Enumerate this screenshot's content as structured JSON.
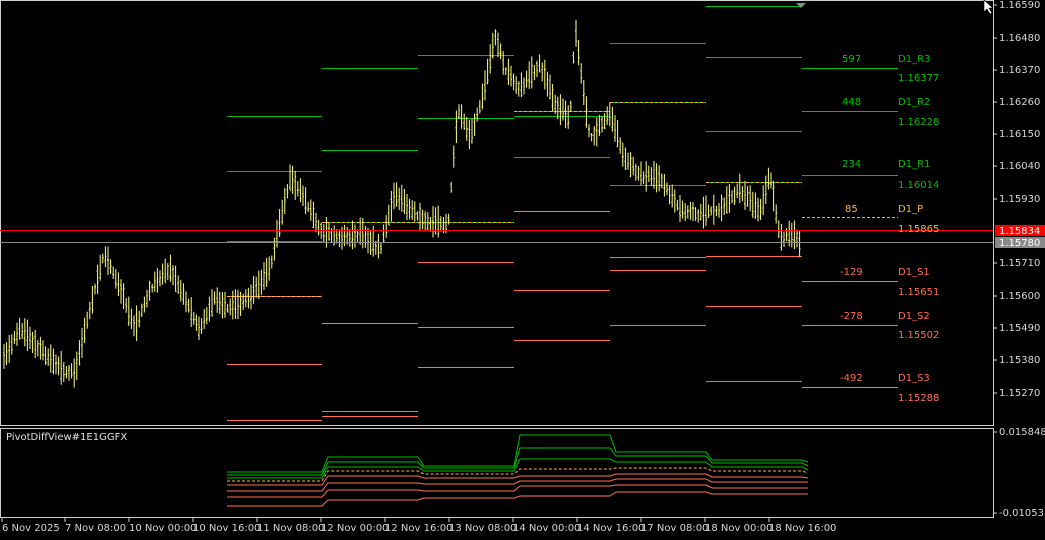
{
  "window": {
    "indicator_title": "PivotDiffView#1E1GGFX"
  },
  "colors": {
    "background": "#000000",
    "frame": "#cfcfcf",
    "candle": "#ffff80",
    "resistance": "#00c000",
    "pivot": "#ffb040",
    "support": "#ff7050",
    "bid_line": "#ff0000",
    "ask_line": "#8a8a8a",
    "tag_bid_bg": "#ff0000",
    "tag_ask_bg": "#8a8a8a"
  },
  "price_axis": {
    "labels": [
      "1.16590",
      "1.16480",
      "1.16370",
      "1.16260",
      "1.16150",
      "1.16040",
      "1.15930",
      "1.15710",
      "1.15600",
      "1.15490",
      "1.15380",
      "1.15270"
    ],
    "bid_tag": "1.15834",
    "ask_tag": "1.15780"
  },
  "indicator_axis": {
    "top": "0.015848",
    "bottom": "-0.010535"
  },
  "time_axis": [
    "6 Nov 2025",
    "7 Nov 08:00",
    "10 Nov 00:00",
    "10 Nov 16:00",
    "11 Nov 08:00",
    "12 Nov 00:00",
    "12 Nov 16:00",
    "13 Nov 08:00",
    "14 Nov 00:00",
    "14 Nov 16:00",
    "17 Nov 08:00",
    "18 Nov 00:00",
    "18 Nov 16:00"
  ],
  "pivot_labels": [
    {
      "diff": "597",
      "name": "D1_R3",
      "price": "1.16377",
      "kind": "resistance"
    },
    {
      "diff": "448",
      "name": "D1_R2",
      "price": "1.16228",
      "kind": "resistance"
    },
    {
      "diff": "234",
      "name": "D1_R1",
      "price": "1.16014",
      "kind": "resistance"
    },
    {
      "diff": "85",
      "name": "D1_P",
      "price": "1.15865",
      "kind": "pivot"
    },
    {
      "diff": "-129",
      "name": "D1_S1",
      "price": "1.15651",
      "kind": "support"
    },
    {
      "diff": "-278",
      "name": "D1_S2",
      "price": "1.15502",
      "kind": "support"
    },
    {
      "diff": "-492",
      "name": "D1_S3",
      "price": "1.15288",
      "kind": "support"
    }
  ]
}
